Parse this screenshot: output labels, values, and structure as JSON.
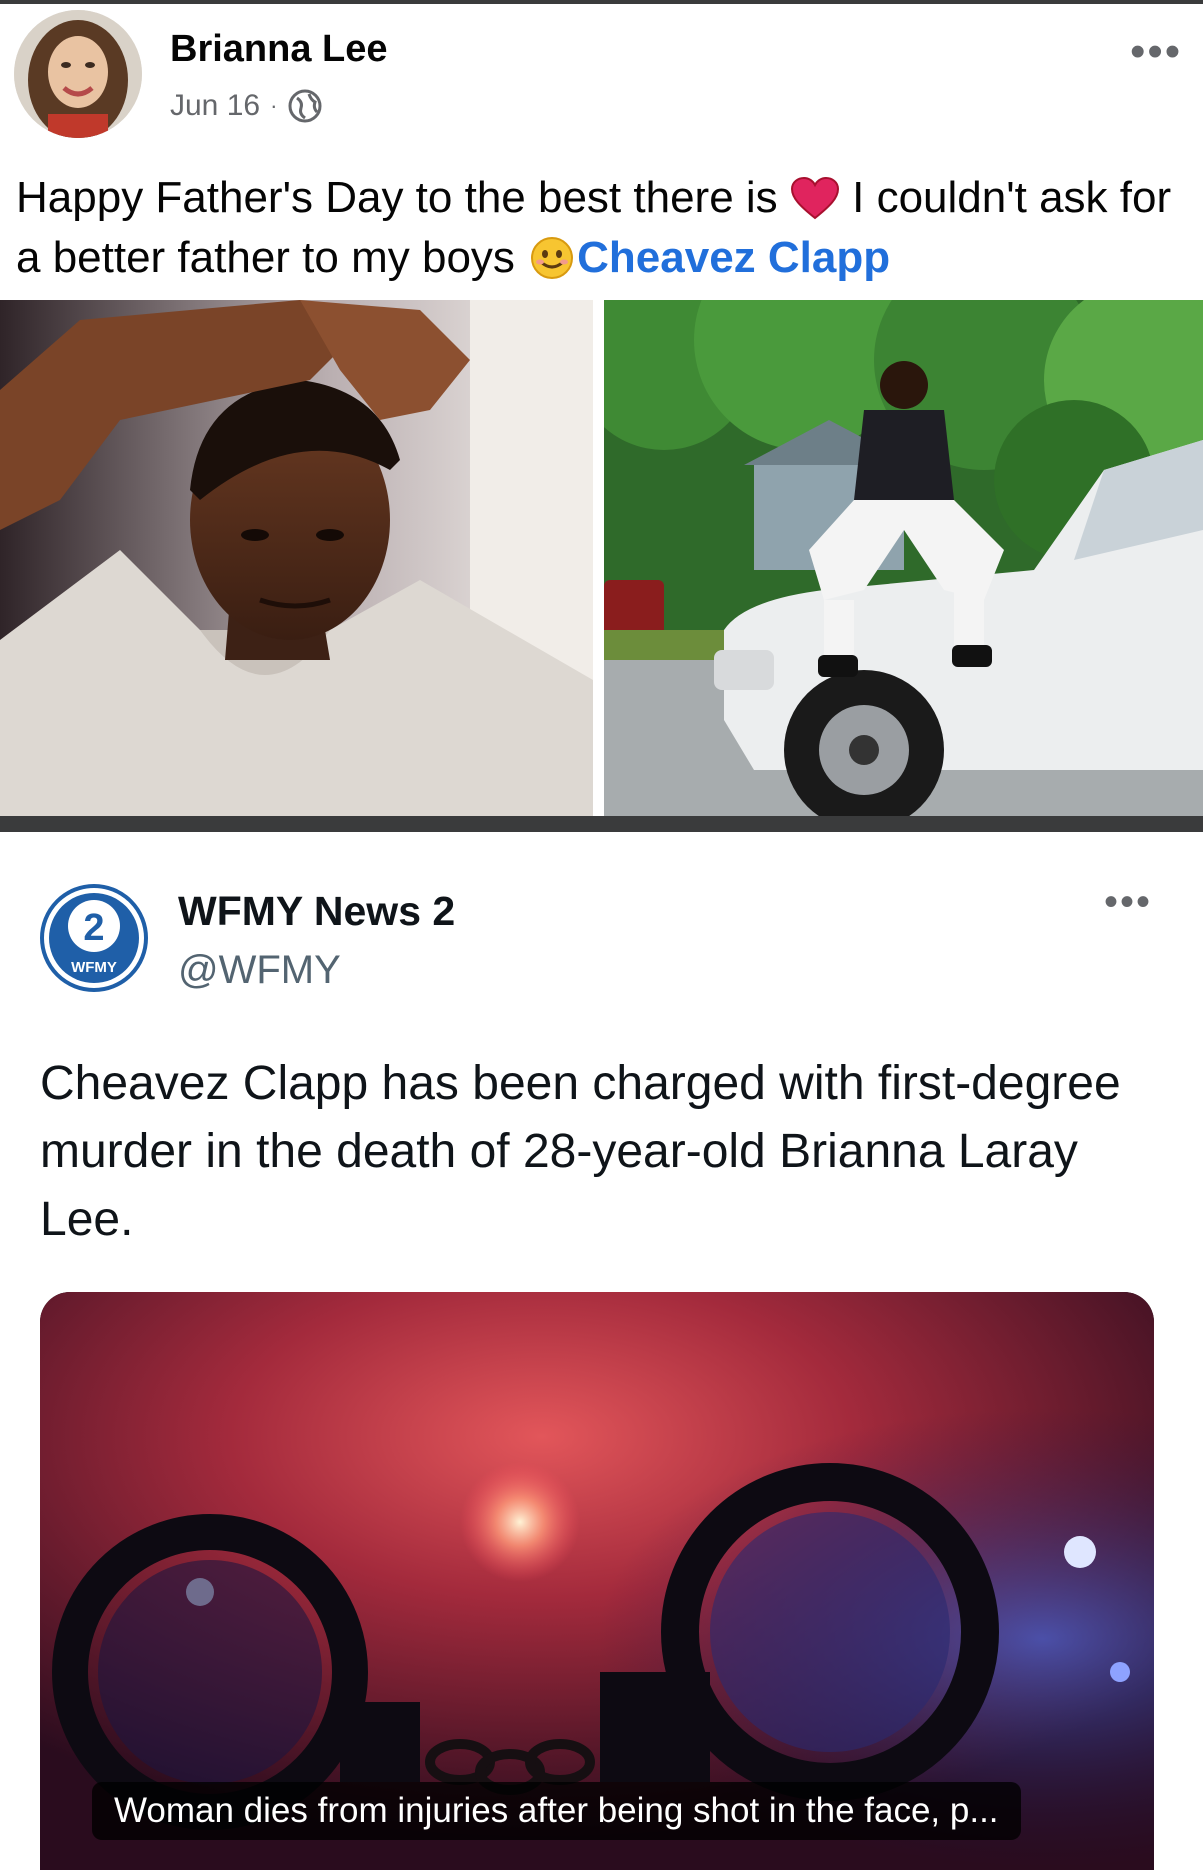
{
  "facebook_post": {
    "author_name": "Brianna Lee",
    "date": "Jun 16",
    "separator": "·",
    "privacy_icon": "globe-icon",
    "more_label": "•••",
    "text_part1": "Happy Father's Day to the best there is ",
    "heart_emoji": "red-heart-icon",
    "text_part2": " I couldn't ask for a better father to my boys ",
    "smile_emoji": "smiling-face-icon",
    "mention": "Cheavez Clapp",
    "photos": [
      "selfie-photo",
      "truck-photo"
    ]
  },
  "tweet": {
    "account_name": "WFMY News 2",
    "handle": "@WFMY",
    "logo_number": "2",
    "logo_text": "WFMY",
    "more_label": "•••",
    "text": "Cheavez Clapp has been charged with first-degree murder in the death of 28-year-old Brianna Laray Lee.",
    "card_caption": "Woman dies from injuries after being shot in the face, p...",
    "card_image": "handcuffs-photo"
  },
  "colors": {
    "mention_blue": "#216fdb",
    "wfmy_blue": "#1f5fa8",
    "divider_gray": "#3a3b3c"
  }
}
